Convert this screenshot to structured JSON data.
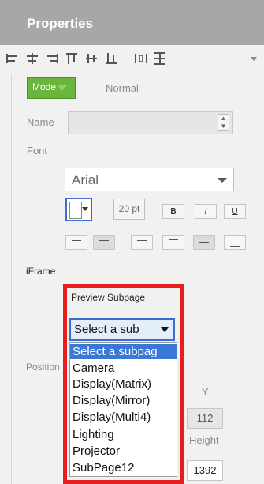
{
  "panel": {
    "title": "Properties"
  },
  "toolbar": {
    "icons": [
      "align-left-icon",
      "align-center-icon",
      "align-right-icon",
      "align-top-icon",
      "align-middle-icon",
      "align-bottom-icon",
      "distribute-horizontal-icon",
      "distribute-vertical-icon",
      "chevron-down-icon"
    ]
  },
  "mode": {
    "label": "Mode",
    "value": "Normal"
  },
  "name": {
    "label": "Name",
    "value": ""
  },
  "font": {
    "label": "Font",
    "family": "Arial",
    "size": "20 pt",
    "bold_label": "B",
    "italic_label": "I",
    "underline_label": "U"
  },
  "iframe": {
    "label": "iFrame",
    "preview_label": "Preview Subpage",
    "selected_value": "Select a sub",
    "options": [
      "Select a subpag",
      "Camera",
      "Display(Matrix)",
      "Display(Mirror)",
      "Display(Multi4)",
      "Lighting",
      "Projector",
      "SubPage12"
    ]
  },
  "position": {
    "label": "Position",
    "y_label": "Y",
    "y_value": "112",
    "height_label": "Height",
    "height_value": "1392"
  },
  "colors": {
    "accent_green": "#6ab53c",
    "highlight_red": "#e61e1e",
    "selection_blue": "#3a78d8"
  }
}
